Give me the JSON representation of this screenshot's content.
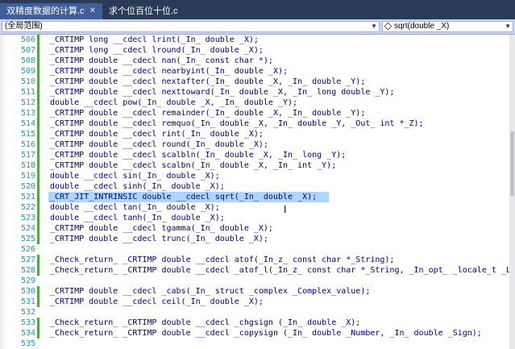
{
  "tabs": [
    {
      "label": "双精度数据的计算.c",
      "active": true
    },
    {
      "label": "求个位百位十位.c",
      "active": false
    }
  ],
  "nav": {
    "scope": "(全局范围)",
    "member": "sqrt(double _X)"
  },
  "lines": [
    {
      "num": "506",
      "code": "_CRTIMP long __cdecl lrint(_In_ double _X);"
    },
    {
      "num": "507",
      "code": "_CRTIMP long __cdecl lround(_In_ double _X);"
    },
    {
      "num": "508",
      "code": "_CRTIMP double __cdecl nan(_In_ const char *);"
    },
    {
      "num": "509",
      "code": "_CRTIMP double __cdecl nearbyint(_In_ double _X);"
    },
    {
      "num": "510",
      "code": "_CRTIMP double __cdecl nextafter(_In_ double _X, _In_ double _Y);"
    },
    {
      "num": "511",
      "code": "_CRTIMP double __cdecl nexttoward(_In_ double _X, _In_ long double _Y);"
    },
    {
      "num": "512",
      "code": "double __cdecl pow(_In_ double _X, _In_ double _Y);"
    },
    {
      "num": "513",
      "code": "_CRTIMP double __cdecl remainder(_In_ double _X, _In_ double _Y);"
    },
    {
      "num": "514",
      "code": "_CRTIMP double __cdecl remquo(_In_ double _X, _In_ double _Y, _Out_ int *_Z);"
    },
    {
      "num": "515",
      "code": "_CRTIMP double __cdecl rint(_In_ double _X);"
    },
    {
      "num": "516",
      "code": "_CRTIMP double __cdecl round(_In_ double _X);"
    },
    {
      "num": "517",
      "code": "_CRTIMP double __cdecl scalbln(_In_ double _X, _In_ long _Y);"
    },
    {
      "num": "518",
      "code": "_CRTIMP double __cdecl scalbn(_In_ double _X, _In_ int _Y);"
    },
    {
      "num": "519",
      "code": "double __cdecl sin(_In_ double _X);"
    },
    {
      "num": "520",
      "code": "double __cdecl sinh(_In_ double _X);"
    },
    {
      "num": "521",
      "code": "_CRT_JIT_INTRINSIC double __cdecl sqrt(_In_ double _X);"
    },
    {
      "num": "522",
      "code": "double __cdecl tan(_In_ double _X);"
    },
    {
      "num": "523",
      "code": "double __cdecl tanh(_In_ double _X);"
    },
    {
      "num": "524",
      "code": "_CRTIMP double __cdecl tgamma(_In_ double _X);"
    },
    {
      "num": "525",
      "code": "_CRTIMP double __cdecl trunc(_In_ double _X);"
    },
    {
      "num": "526",
      "code": ""
    },
    {
      "num": "527",
      "code": "_Check_return_ _CRTIMP double __cdecl atof(_In_z_ const char *_String);"
    },
    {
      "num": "528",
      "code": "_Check_return_ _CRTIMP double __cdecl _atof_l(_In_z_ const char *_String, _In_opt_ _locale_t _Locale);"
    },
    {
      "num": "529",
      "code": ""
    },
    {
      "num": "530",
      "code": "_CRTIMP double __cdecl _cabs(_In_ struct _complex _Complex_value);"
    },
    {
      "num": "531",
      "code": "_CRTIMP double __cdecl ceil(_In_ double _X);"
    },
    {
      "num": "532",
      "code": ""
    },
    {
      "num": "533",
      "code": "_Check_return_ _CRTIMP double __cdecl _chgsign (_In_ double _X);"
    },
    {
      "num": "534",
      "code": "_Check_return_ _CRTIMP double __cdecl _copysign (_In_ double _Number, _In_ double _Sign);"
    },
    {
      "num": "535",
      "code": ""
    },
    {
      "num": "536",
      "code": "_CRTIMP double __cdecl floor(_In_ double _X);"
    }
  ],
  "highlighted_line": "521",
  "colors": {
    "line_numbers": "#2b91af",
    "code": "#000080",
    "selection": "#add6ff",
    "tab_active": "#3e5f98"
  }
}
